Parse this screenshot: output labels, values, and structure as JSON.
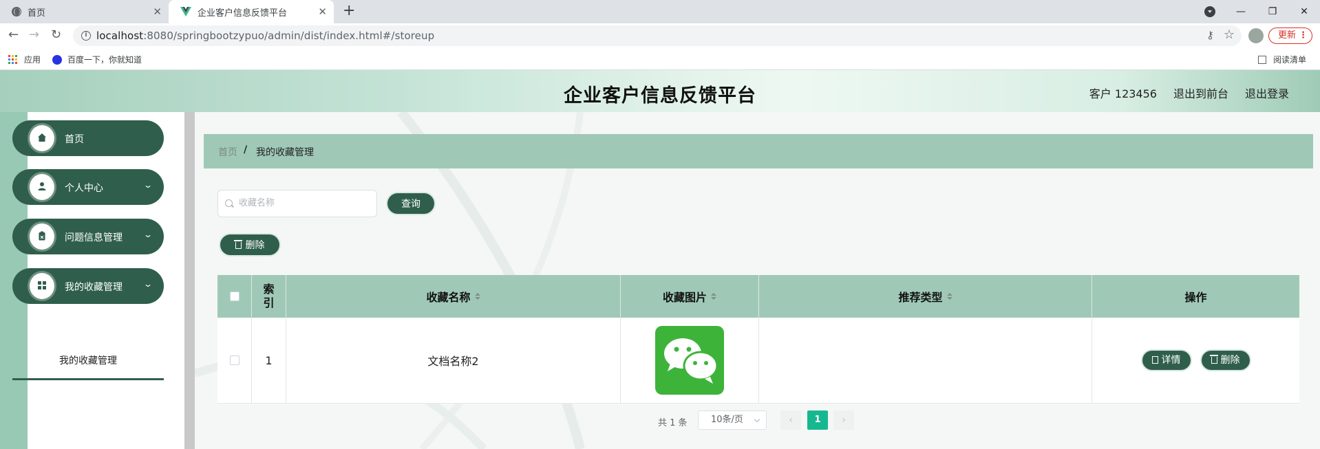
{
  "browser": {
    "tabs": [
      {
        "title": "首页",
        "active": false
      },
      {
        "title": "企业客户信息反馈平台",
        "active": true
      }
    ],
    "url_host": "localhost",
    "url_rest": ":8080/springbootzypuo/admin/dist/index.html#/storeup",
    "update_label": "更新",
    "bookmarks": {
      "apps": "应用",
      "baidu": "百度一下，你就知道",
      "reading_list": "阅读清单"
    }
  },
  "app": {
    "title": "企业客户信息反馈平台",
    "header_links": {
      "user": "客户 123456",
      "to_front": "退出到前台",
      "logout": "退出登录"
    }
  },
  "sidebar": {
    "items": [
      {
        "label": "首页",
        "icon": "home-icon",
        "has_children": false
      },
      {
        "label": "个人中心",
        "icon": "user-icon",
        "has_children": true
      },
      {
        "label": "问题信息管理",
        "icon": "clipboard-icon",
        "has_children": true
      },
      {
        "label": "我的收藏管理",
        "icon": "grid-icon",
        "has_children": true
      }
    ],
    "submenu": {
      "label": "我的收藏管理"
    }
  },
  "breadcrumb": {
    "home": "首页",
    "separator": "/",
    "current": "我的收藏管理"
  },
  "search": {
    "placeholder": "收藏名称",
    "query_label": "查询"
  },
  "actions": {
    "delete_label": "删除"
  },
  "table": {
    "columns": {
      "index": "索引",
      "name": "收藏名称",
      "image": "收藏图片",
      "type": "推荐类型",
      "ops": "操作"
    },
    "rows": [
      {
        "index": "1",
        "name": "文档名称2",
        "image": "wechat-logo",
        "type": "",
        "detail_label": "详情",
        "delete_label": "删除"
      }
    ]
  },
  "pagination": {
    "total": "共 1 条",
    "page_size": "10条/页",
    "current_page": "1"
  },
  "colors": {
    "primary": "#2f5f4c",
    "header_bg": "#9fc9b6",
    "active_page": "#17b890",
    "wechat": "#3eb33a"
  }
}
